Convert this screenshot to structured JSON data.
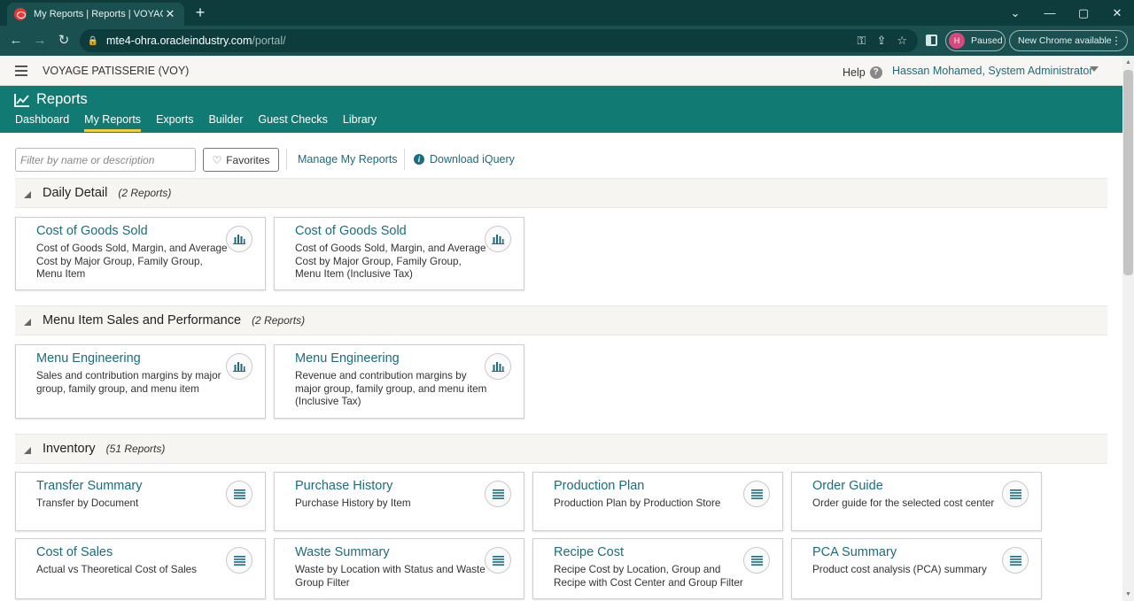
{
  "browser": {
    "tab_title": "My Reports | Reports | VOYAGE P",
    "url_host": "mte4-ohra.oracleindustry.com",
    "url_path": "/portal/",
    "profile_initial": "H",
    "profile_status": "Paused",
    "update_label": "New Chrome available",
    "accent": "#1a5050"
  },
  "app": {
    "org_name": "VOYAGE PATISSERIE (VOY)",
    "help_label": "Help",
    "user_name": "Hassan Mohamed, System Administrator",
    "module_title": "Reports",
    "brand_color": "#117b73",
    "active_tab_color": "#f0cf3a",
    "nav_tabs": [
      "Dashboard",
      "My Reports",
      "Exports",
      "Builder",
      "Guest Checks",
      "Library"
    ]
  },
  "toolbar": {
    "filter_placeholder": "Filter by name or description",
    "favorites_label": "Favorites",
    "manage_label": "Manage My Reports",
    "download_label": "Download iQuery"
  },
  "sections": [
    {
      "title": "Daily Detail",
      "count": "(2 Reports)",
      "cards": [
        {
          "title": "Cost of Goods Sold",
          "desc": "Cost of Goods Sold, Margin, and Average Cost by Major Group, Family Group, Menu Item",
          "icon": "chart-icon"
        },
        {
          "title": "Cost of Goods Sold",
          "desc": "Cost of Goods Sold, Margin, and Average Cost by Major Group, Family Group, Menu Item (Inclusive Tax)",
          "icon": "chart-icon"
        }
      ]
    },
    {
      "title": "Menu Item Sales and Performance",
      "count": "(2 Reports)",
      "cards": [
        {
          "title": "Menu Engineering",
          "desc": "Sales and contribution margins by major group, family group, and menu item",
          "icon": "chart-icon"
        },
        {
          "title": "Menu Engineering",
          "desc": "Revenue and contribution margins by major group, family group, and menu item (Inclusive Tax)",
          "icon": "chart-icon"
        }
      ]
    },
    {
      "title": "Inventory",
      "count": "(51 Reports)",
      "cards": [
        {
          "title": "Transfer Summary",
          "desc": "Transfer by Document",
          "icon": "list-icon"
        },
        {
          "title": "Purchase History",
          "desc": "Purchase History by Item",
          "icon": "list-icon"
        },
        {
          "title": "Production Plan",
          "desc": "Production Plan by Production Store",
          "icon": "list-icon"
        },
        {
          "title": "Order Guide",
          "desc": "Order guide for the selected cost center",
          "icon": "list-icon"
        },
        {
          "title": "Cost of Sales",
          "desc": "Actual vs Theoretical Cost of Sales",
          "icon": "list-icon"
        },
        {
          "title": "Waste Summary",
          "desc": "Waste by Location with Status and Waste Group Filter",
          "icon": "list-icon"
        },
        {
          "title": "Recipe Cost",
          "desc": "Recipe Cost by Location, Group and Recipe with Cost Center and Group Filter",
          "icon": "list-icon"
        },
        {
          "title": "PCA Summary",
          "desc": "Product cost analysis (PCA) summary",
          "icon": "list-icon"
        }
      ]
    }
  ]
}
